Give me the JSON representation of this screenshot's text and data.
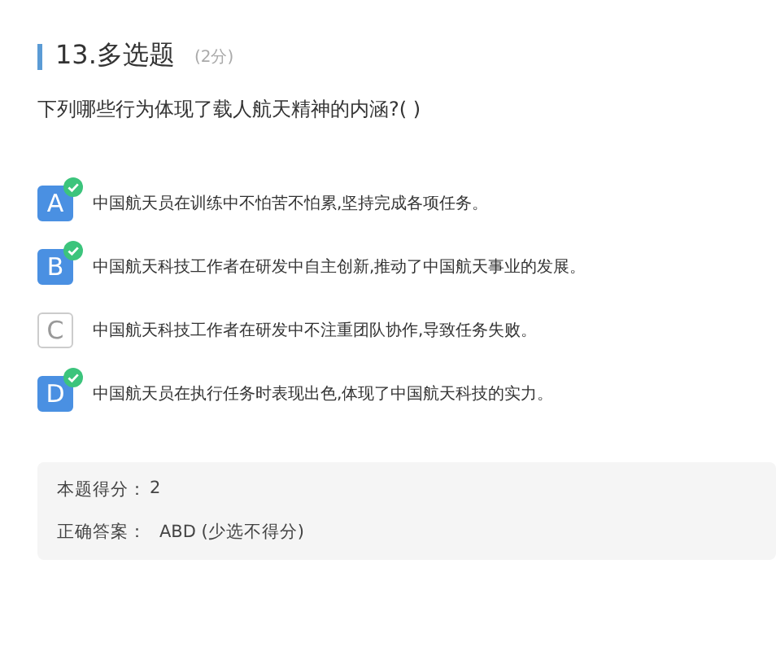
{
  "question": {
    "number_title": "13.多选题",
    "points": "(2分)",
    "text": "下列哪些行为体现了载人航天精神的内涵?(  )"
  },
  "options": [
    {
      "letter": "A",
      "text": "中国航天员在训练中不怕苦不怕累,坚持完成各项任务。",
      "selected": true
    },
    {
      "letter": "B",
      "text": "中国航天科技工作者在研发中自主创新,推动了中国航天事业的发展。",
      "selected": true
    },
    {
      "letter": "C",
      "text": "中国航天科技工作者在研发中不注重团队协作,导致任务失败。",
      "selected": false
    },
    {
      "letter": "D",
      "text": "中国航天员在执行任务时表现出色,体现了中国航天科技的实力。",
      "selected": true
    }
  ],
  "result": {
    "score_label": "本题得分：",
    "score": "2",
    "answer_label": "正确答案：",
    "answer": "ABD (少选不得分)"
  }
}
